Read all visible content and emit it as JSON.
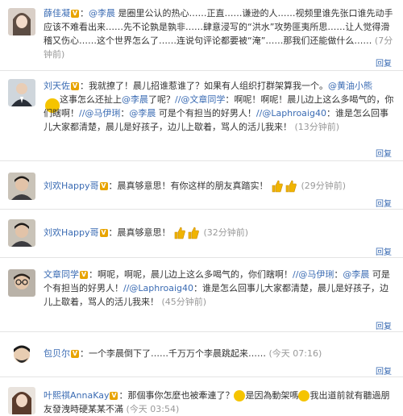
{
  "colors": {
    "link": "#3a6bb3",
    "badge": "#e8a400",
    "time": "#999999"
  },
  "comments": [
    {
      "avatar_icon": "woman-avatar-icon",
      "name": "薛佳凝",
      "mention": "@李晨",
      "text": "是圈里公认的热心……正直……谦逊的人……视频里谁先张口谁先动手应该不难看出来……先不论孰是孰非……肆意浸写的“洪水”攻势匪夷所思……让人觉得滑稽又伤心……这个世界怎么了……连说句评论都要被“淹”……那我们还能做什么……",
      "time": "(7分钟前)",
      "reply": "回复"
    },
    {
      "avatar_icon": "man-suit-avatar-icon",
      "name": "刘天佐",
      "text1": "我就撩了！晨儿招谁惹谁了？如果有人组织打群架算我一个。",
      "mention1": "@黄油小熊",
      "text2": "这事怎么还扯上",
      "mention2": "@李晨",
      "text3": "了呢？",
      "mention3": "//@文章同学",
      "text4": "：啊呢！啊呢！晨儿边上这么多喝气的，你们瞎啊！",
      "mention4": "//@马伊琍",
      "mention5": "@李晨",
      "text5": "可是个有担当的好男人！",
      "mention6": "//@Laphroaig40",
      "text6": "谁是怎么回事儿大家都清楚，晨儿是好孩子，边儿上歇着，骂人的活儿我来！",
      "time": "(13分钟前)",
      "reply": "回复"
    },
    {
      "avatar_icon": "man-avatar-icon",
      "name": "刘欢Happy哥",
      "text": "晨真够意思！有你这样的朋友真踏实！",
      "time": "(29分钟前)",
      "reply": "回复"
    },
    {
      "avatar_icon": "man-avatar-icon",
      "name": "刘欢Happy哥",
      "text": "晨真够意思！",
      "time": "(32分钟前)",
      "reply": "回复"
    },
    {
      "avatar_icon": "man-glasses-avatar-icon",
      "name": "文章同学",
      "text1": "：啊呢，啊呢，晨儿边上这么多喝气的，你们瞎啊！",
      "mention1": "//@马伊琍",
      "mention2": "@李晨",
      "text2": "可是个有担当的好男人！",
      "mention3": "//@Laphroaig40",
      "text3": "谁是怎么回事儿大家都清楚，晨儿是好孩子，边儿上歇着，骂人的活儿我来！",
      "time": "(45分钟前)",
      "reply": "回复"
    },
    {
      "avatar_icon": "bearded-man-avatar-icon",
      "name": "包贝尔",
      "text": "一个李晨倒下了……千万万个李晨跳起来……",
      "time": "(今天 07:16)",
      "reply": "回复"
    },
    {
      "avatar_icon": "woman-avatar-icon",
      "name": "叶熙祺AnnaKay",
      "text1": "那個事你怎麼也被牽連了？",
      "text2": "是因為動架嗎",
      "text3": "我出道前就有聽過朋友發洩時硬某某不滿",
      "time": "(今天 03:54)",
      "reply": "回复"
    }
  ]
}
